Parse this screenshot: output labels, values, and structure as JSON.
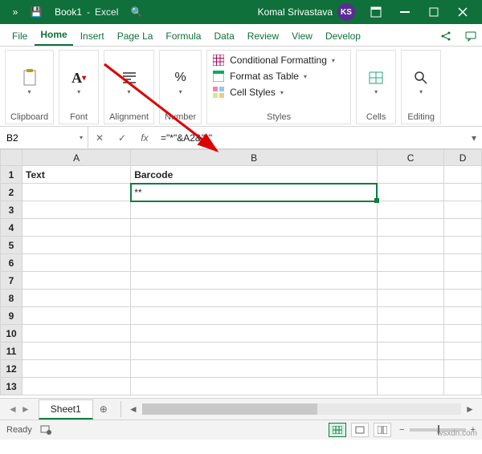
{
  "title": {
    "chevrons": "»",
    "save": "💾",
    "doc": "Book1",
    "dash": "-",
    "app": "Excel",
    "search": "🔍"
  },
  "user": {
    "name": "Komal Srivastava",
    "initials": "KS"
  },
  "tabs": {
    "file": "File",
    "home": "Home",
    "insert": "Insert",
    "pageLayout": "Page La",
    "formulas": "Formula",
    "data": "Data",
    "review": "Review",
    "view": "View",
    "developer": "Develop"
  },
  "groups": {
    "clipboard": {
      "label": "Clipboard"
    },
    "font": {
      "label": "Font"
    },
    "alignment": {
      "label": "Alignment"
    },
    "number": {
      "label": "Number"
    },
    "styles": {
      "label": "Styles",
      "cond": "Conditional Formatting",
      "table": "Format as Table",
      "cell": "Cell Styles"
    },
    "cells": {
      "label": "Cells"
    },
    "editing": {
      "label": "Editing"
    }
  },
  "namebox": "B2",
  "formula": "=\"*\"&A2&\"*\"",
  "columns": [
    "A",
    "B",
    "C",
    "D"
  ],
  "rows": [
    "1",
    "2",
    "3",
    "4",
    "5",
    "6",
    "7",
    "8",
    "9",
    "10",
    "11",
    "12",
    "13"
  ],
  "cells": {
    "A1": "Text",
    "B1": "Barcode",
    "B2": "**"
  },
  "sheet": {
    "name": "Sheet1",
    "add": "⊕"
  },
  "status": {
    "ready": "Ready",
    "zoom_minus": "−",
    "zoom_plus": "+"
  },
  "watermark": "wsxdn.com"
}
